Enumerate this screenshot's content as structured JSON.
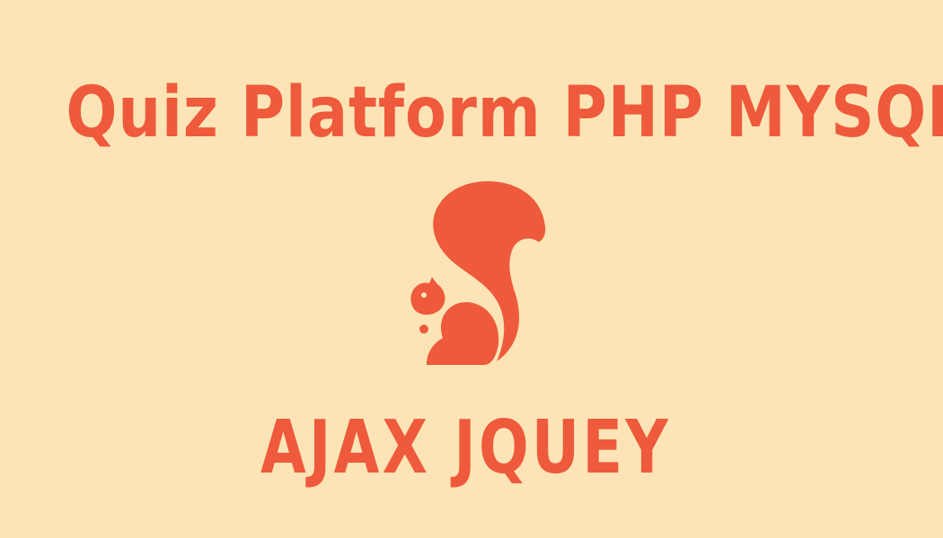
{
  "colors": {
    "background": "#fde4b6",
    "accent": "#ee5a3b"
  },
  "title": "Quiz Platform PHP MYSQL",
  "logo": {
    "icon": "squirrel-icon"
  },
  "subtitle": "AJAX JQUEY"
}
